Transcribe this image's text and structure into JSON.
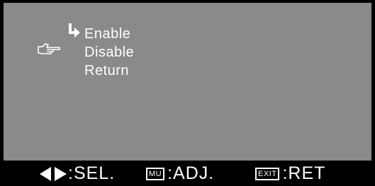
{
  "menu": {
    "items": [
      {
        "label": "Enable",
        "current": true
      },
      {
        "label": "Disable",
        "pointed": true
      },
      {
        "label": "Return"
      }
    ]
  },
  "icons": {
    "current_marker": "return-arrow-icon",
    "pointer": "pointing-hand-icon",
    "select": "left-right-arrows-icon"
  },
  "footer": {
    "sel_label": ":SEL.",
    "mu_key": "MU",
    "adj_label": ":ADJ.",
    "exit_key": "EXIT",
    "ret_label": ":RET"
  },
  "colors": {
    "panel": "#8a8a8a",
    "background": "#000000",
    "text": "#ffffff"
  }
}
